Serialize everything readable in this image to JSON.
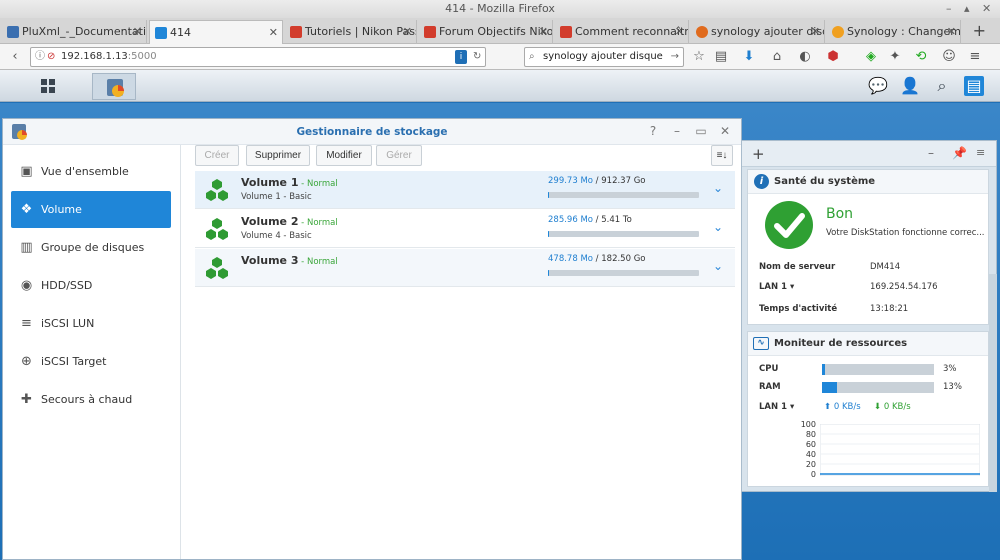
{
  "browser": {
    "window_title": "414 - Mozilla Firefox",
    "tabs": [
      {
        "label": "PluXml_-_Documentation.p",
        "color": "#3b6fb0"
      },
      {
        "label": "414",
        "color": "#1f86d8"
      },
      {
        "label": "Tutoriels | Nikon Pass",
        "color": "#d23c2c"
      },
      {
        "label": "Forum Objectifs Nikon",
        "color": "#d23c2c"
      },
      {
        "label": "Comment reconnaître",
        "color": "#d23c2c"
      },
      {
        "label": "synology ajouter disqu",
        "color": "#e06b1e"
      },
      {
        "label": "Synology : Changeme",
        "color": "#f0a020"
      }
    ],
    "url_host": "192.168.1.13",
    "url_port": ":5000",
    "search_value": "synology ajouter disque"
  },
  "app": {
    "title": "Gestionnaire de stockage",
    "sidebar": [
      {
        "label": "Vue d'ensemble",
        "icon": "overview-icon",
        "glyph": "▣"
      },
      {
        "label": "Volume",
        "icon": "volume-icon",
        "glyph": "❖"
      },
      {
        "label": "Groupe de disques",
        "icon": "disk-group-icon",
        "glyph": "▥"
      },
      {
        "label": "HDD/SSD",
        "icon": "hdd-icon",
        "glyph": "◉"
      },
      {
        "label": "iSCSI LUN",
        "icon": "lun-icon",
        "glyph": "≡"
      },
      {
        "label": "iSCSI Target",
        "icon": "target-icon",
        "glyph": "⊕"
      },
      {
        "label": "Secours à chaud",
        "icon": "hotspare-icon",
        "glyph": "✚"
      }
    ],
    "toolbar": {
      "create": "Créer",
      "delete": "Supprimer",
      "modify": "Modifier",
      "manage": "Gérer"
    },
    "volumes": [
      {
        "name": "Volume 1",
        "status": " - Normal",
        "sub": "Volume 1 - Basic",
        "used": "299.73 Mo",
        "total": " / 912.37 Go",
        "fraction": 0.001
      },
      {
        "name": "Volume 2",
        "status": " - Normal",
        "sub": "Volume 4 - Basic",
        "used": "285.96 Mo",
        "total": " / 5.41 To",
        "fraction": 0.001
      },
      {
        "name": "Volume 3",
        "status": " - Normal",
        "sub": "",
        "used": "478.78 Mo",
        "total": " / 182.50 Go",
        "fraction": 0.003
      }
    ]
  },
  "widgets": {
    "health": {
      "title": "Santé du système",
      "status": "Bon",
      "message": "Votre DiskStation fonctionne correc...",
      "server_label": "Nom de serveur",
      "server_value": "DM414",
      "lan_label": "LAN 1",
      "lan_value": "169.254.54.176",
      "uptime_label": "Temps d'activité",
      "uptime_value": "13:18:21"
    },
    "monitor": {
      "title": "Moniteur de ressources",
      "cpu_label": "CPU",
      "cpu_value": "3%",
      "cpu_fraction": 0.03,
      "ram_label": "RAM",
      "ram_value": "13%",
      "ram_fraction": 0.13,
      "lan_label": "LAN 1",
      "up": "0 KB/s",
      "down": "0 KB/s",
      "y_ticks": [
        "100",
        "80",
        "60",
        "40",
        "20",
        "0"
      ]
    }
  },
  "colors": {
    "accent": "#1f86d8",
    "ok": "#3aa63a",
    "cube": "#2f9b33"
  }
}
